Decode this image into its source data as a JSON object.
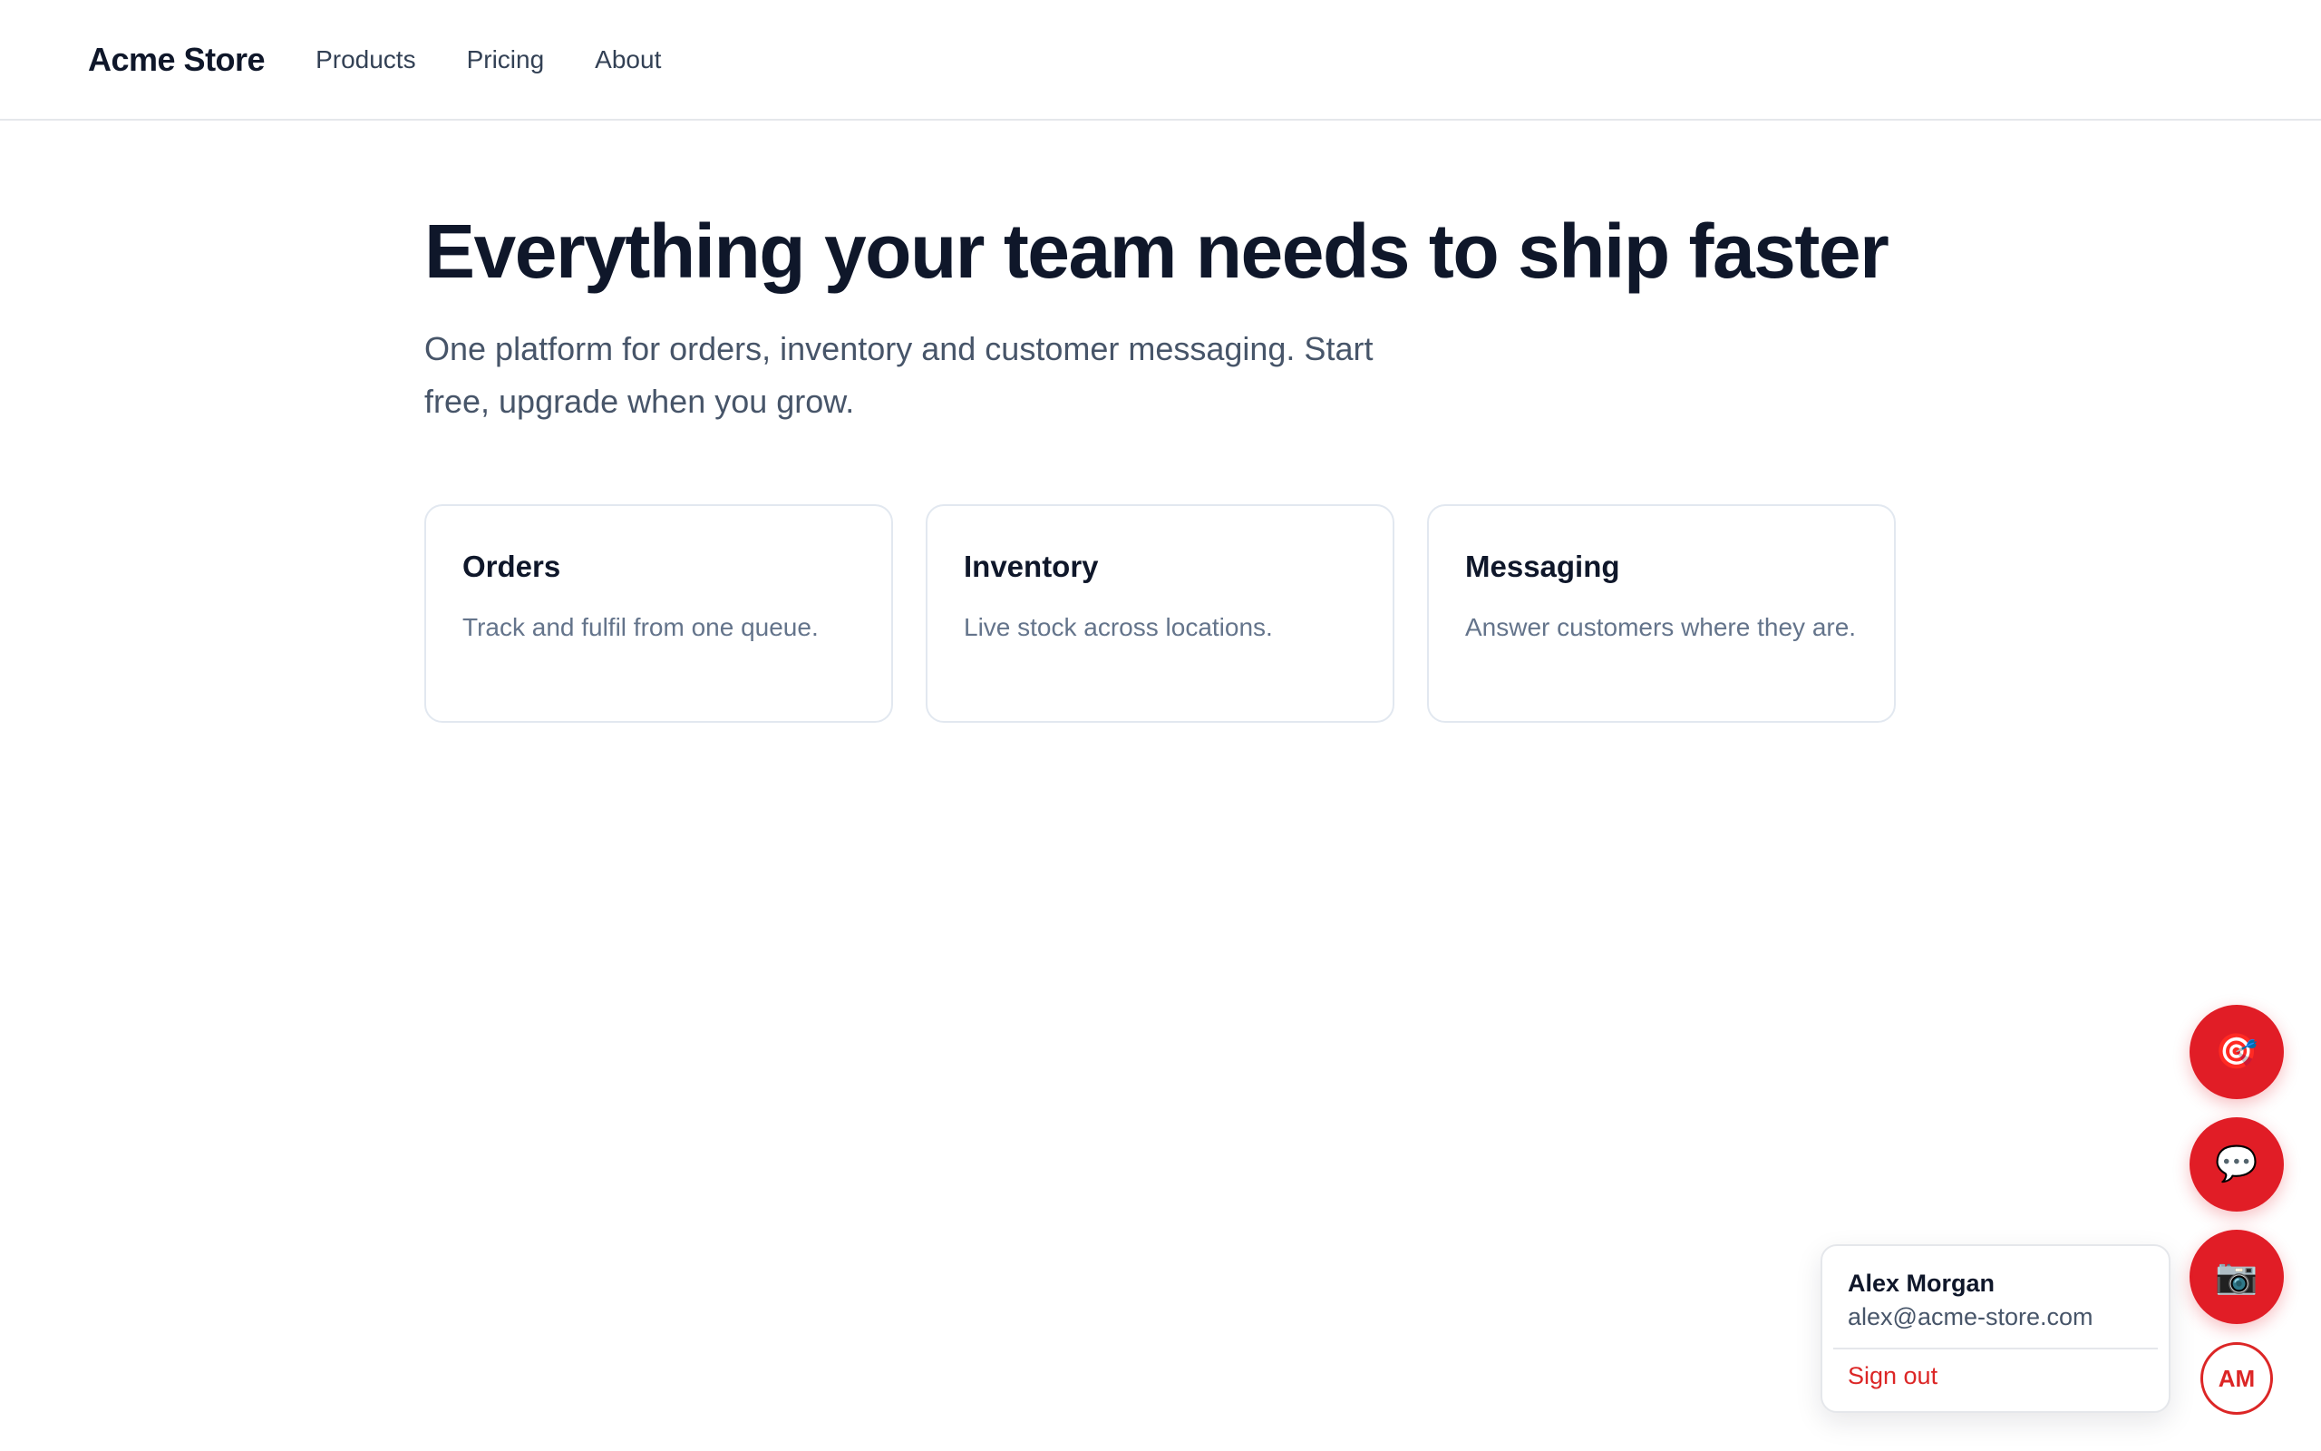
{
  "header": {
    "brand": "Acme Store",
    "nav": [
      {
        "label": "Products"
      },
      {
        "label": "Pricing"
      },
      {
        "label": "About"
      }
    ]
  },
  "hero": {
    "title": "Everything your team needs to ship faster",
    "subtitle": "One platform for orders, inventory and customer messaging. Start free, upgrade when you grow."
  },
  "features": [
    {
      "title": "Orders",
      "description": "Track and fulfil from one queue."
    },
    {
      "title": "Inventory",
      "description": "Live stock across locations."
    },
    {
      "title": "Messaging",
      "description": "Answer customers where they are."
    }
  ],
  "floating_actions": {
    "target_icon": "🎯",
    "chat_icon": "💬",
    "camera_icon": "📷",
    "accent_color": "#e11d26"
  },
  "user_menu": {
    "initials": "AM",
    "name": "Alex Morgan",
    "email": "alex@acme-store.com",
    "sign_out": "Sign out"
  }
}
